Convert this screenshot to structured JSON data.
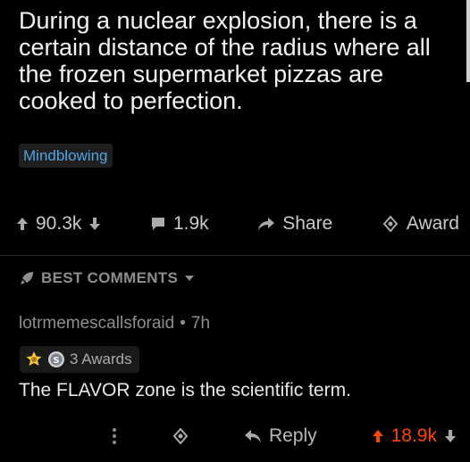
{
  "post": {
    "title": "During a nuclear explosion, there is a certain distance of the radius where all the frozen supermarket pizzas are cooked to perfection.",
    "flair": "Mindblowing",
    "score": "90.3k",
    "comments": "1.9k",
    "share_label": "Share",
    "award_label": "Award"
  },
  "sort": {
    "label": "BEST COMMENTS"
  },
  "comment": {
    "author": "lotrmemescallsforaid",
    "separator": "•",
    "age": "7h",
    "awards_label": "3 Awards",
    "body": "The FLAVOR zone is the scientific term.",
    "reply_label": "Reply",
    "score": "18.9k"
  },
  "icons": {
    "upvote": "upvote-arrow-icon",
    "downvote": "downvote-arrow-icon",
    "comment": "comment-bubble-icon",
    "share": "share-arrow-icon",
    "award": "award-icon",
    "best": "rocket-icon",
    "more": "more-vertical-icon",
    "reply": "reply-arrow-icon"
  },
  "colors": {
    "background": "#000000",
    "flair_text": "#4fa3e2",
    "upvoted": "#ff4500",
    "muted": "#8c8f91"
  }
}
